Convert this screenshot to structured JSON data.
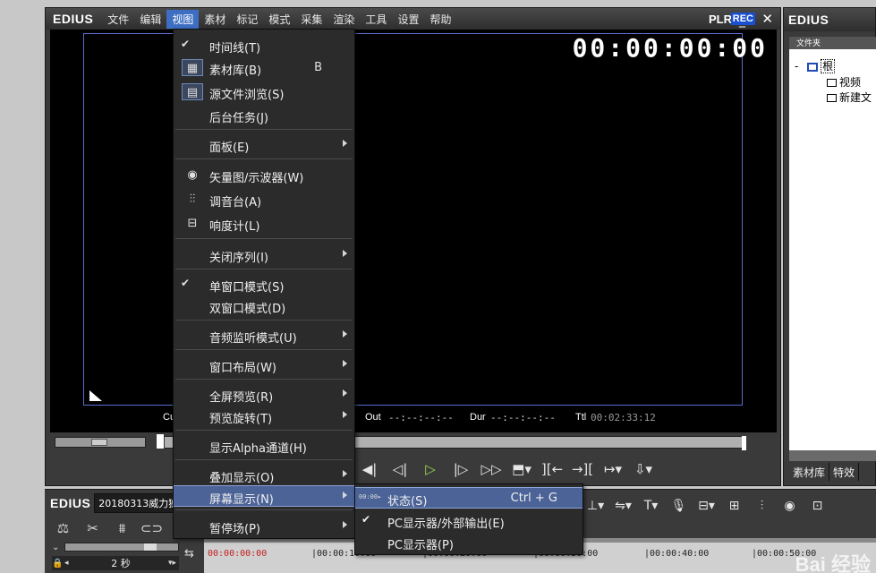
{
  "app": {
    "brand": "EDIUS",
    "menus": [
      "文件",
      "编辑",
      "视图",
      "素材",
      "标记",
      "模式",
      "采集",
      "渲染",
      "工具",
      "设置",
      "帮助"
    ],
    "plr": "PLR",
    "rec": "REC"
  },
  "player": {
    "timecode": "00:00:00:00",
    "cur_label": "Cu",
    "out_label": "Out",
    "out_value": "--:--:--:--",
    "dur_label": "Dur",
    "dur_value": "--:--:--:--",
    "ttl_label": "Ttl",
    "ttl_value": "00:02:33:12"
  },
  "view_menu": {
    "items": [
      {
        "label": "时间线(T)",
        "checked": true
      },
      {
        "label": "素材库(B)",
        "shortcut": "B",
        "icon": "bin-icon"
      },
      {
        "label": "源文件浏览(S)",
        "icon": "source-browser-icon"
      },
      {
        "label": "后台任务(J)"
      },
      {
        "label": "面板(E)",
        "submenu": true
      },
      {
        "label": "矢量图/示波器(W)",
        "icon": "vectorscope-icon"
      },
      {
        "label": "调音台(A)",
        "icon": "mixer-icon"
      },
      {
        "label": "响度计(L)",
        "icon": "loudness-meter-icon"
      },
      {
        "label": "关闭序列(I)",
        "submenu": true
      },
      {
        "label": "单窗口模式(S)",
        "checked": true
      },
      {
        "label": "双窗口模式(D)"
      },
      {
        "label": "音频监听模式(U)",
        "submenu": true
      },
      {
        "label": "窗口布局(W)",
        "submenu": true
      },
      {
        "label": "全屏预览(R)",
        "submenu": true
      },
      {
        "label": "预览旋转(T)",
        "submenu": true
      },
      {
        "label": "显示Alpha通道(H)"
      },
      {
        "label": "叠加显示(O)",
        "submenu": true
      },
      {
        "label": "屏幕显示(N)",
        "submenu": true,
        "highlighted": true
      },
      {
        "label": "暂停场(P)",
        "submenu": true
      }
    ]
  },
  "screen_display_submenu": {
    "items": [
      {
        "label": "状态(S)",
        "shortcut": "Ctrl + G",
        "icon_text": "00:00▸",
        "highlighted": true
      },
      {
        "label": "PC显示器/外部输出(E)",
        "checked": true
      },
      {
        "label": "PC显示器(P)"
      }
    ]
  },
  "bin": {
    "brand": "EDIUS",
    "folder_header": "文件夹",
    "tree": [
      {
        "label": "根",
        "expander": "-"
      },
      {
        "label": "视频"
      },
      {
        "label": "新建文"
      }
    ],
    "tabs": [
      "素材库",
      "特效"
    ]
  },
  "timeline": {
    "brand": "EDIUS",
    "project": "20180313威力狮",
    "zoom_label": "2 秒",
    "ruler": [
      "00:00:00:00",
      "|00:00:10:00",
      "|00:00:20:00",
      "|00:00:30:00",
      "|00:00:40:00",
      "|00:00:50:00"
    ],
    "watermark": "Bai 经验"
  }
}
